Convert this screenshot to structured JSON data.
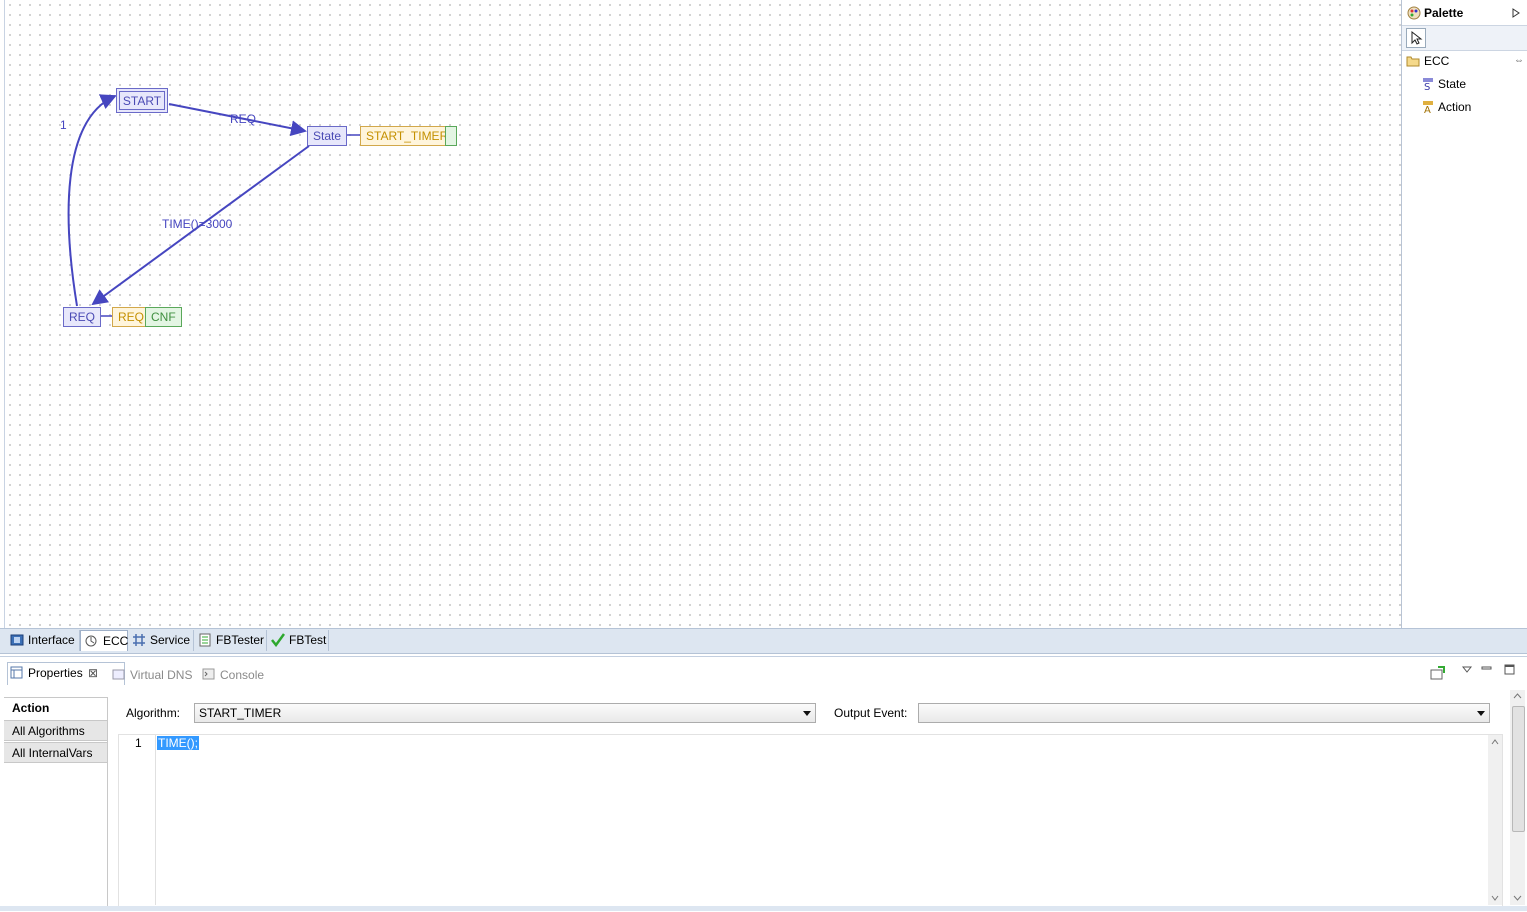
{
  "ecc": {
    "states": {
      "start": "START",
      "state": "State",
      "req": "REQ"
    },
    "actions": {
      "start_timer": "START_TIMER",
      "req_algo": "REQ",
      "req_event": "CNF"
    },
    "transitions": {
      "start_to_state": "REQ",
      "state_to_req": "TIME()=3000",
      "req_to_start": "1"
    }
  },
  "palette": {
    "title": "Palette",
    "group": "ECC",
    "items": [
      "State",
      "Action"
    ]
  },
  "editor_tabs": [
    {
      "label": "Interface",
      "icon": "interface-icon"
    },
    {
      "label": "ECC",
      "icon": "ecc-icon",
      "active": true
    },
    {
      "label": "Service",
      "icon": "service-icon"
    },
    {
      "label": "FBTester",
      "icon": "fbtester-icon"
    },
    {
      "label": "FBTest",
      "icon": "checkmark-icon"
    }
  ],
  "views": {
    "properties": "Properties",
    "virtual_dns": "Virtual DNS",
    "console": "Console"
  },
  "properties": {
    "side_tabs": [
      "Action",
      "All Algorithms",
      "All InternalVars"
    ],
    "algorithm_label": "Algorithm:",
    "algorithm_value": "START_TIMER",
    "output_event_label": "Output Event:",
    "output_event_value": "",
    "line_number": "1",
    "code": "TIME();"
  },
  "colors": {
    "state_border": "#6a6ac8",
    "algorithm_fill": "#fff5dc",
    "event_fill": "#e3f5e3",
    "transition": "#4646c0",
    "selection": "#3399ff"
  }
}
